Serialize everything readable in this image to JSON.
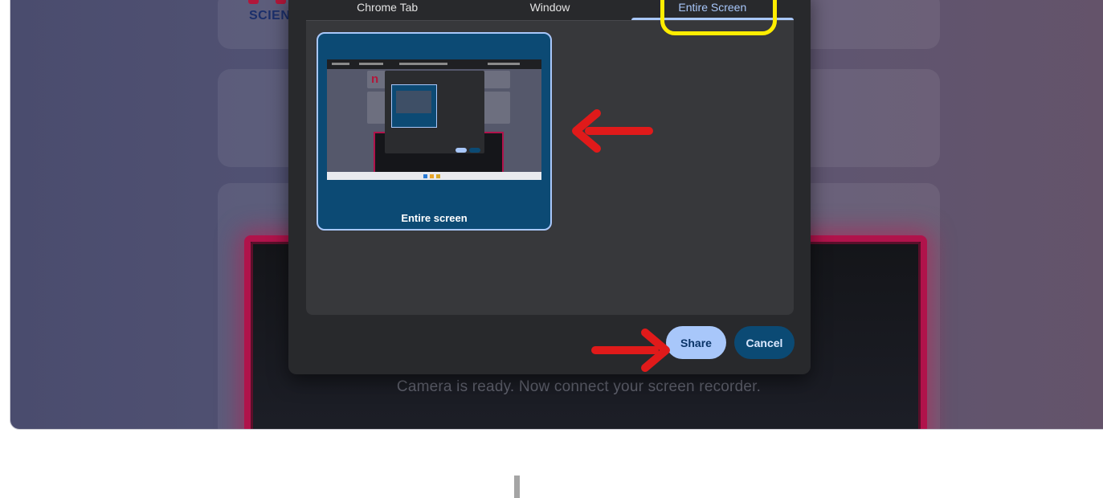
{
  "dialog": {
    "tabs": [
      {
        "label": "Chrome Tab",
        "active": false
      },
      {
        "label": "Window",
        "active": false
      },
      {
        "label": "Entire Screen",
        "active": true
      }
    ],
    "source": {
      "label": "Entire screen",
      "selected": true
    },
    "buttons": {
      "share": "Share",
      "cancel": "Cancel"
    }
  },
  "background_page": {
    "logo_text": "SCIENC",
    "camera_message": "Camera is ready. Now connect your screen recorder."
  },
  "annotations": {
    "highlight_color": "#ffed00",
    "arrow_color": "#e01a1a"
  },
  "colors": {
    "accent": "#a8c7fa",
    "dialog_bg": "#28292c",
    "panel_bg": "#37383b",
    "cancel_bg": "#0b4a74",
    "brand": "#b2173a"
  }
}
